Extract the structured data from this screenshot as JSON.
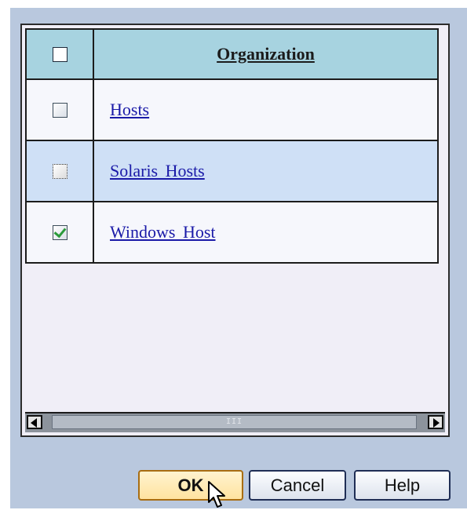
{
  "table": {
    "header": {
      "select_all_checked": false,
      "column_label": "Organization"
    },
    "rows": [
      {
        "label": "Hosts",
        "checked": false,
        "focused": false
      },
      {
        "label": "Solaris Hosts",
        "checked": false,
        "focused": true
      },
      {
        "label": "Windows Host",
        "checked": true,
        "focused": false
      }
    ]
  },
  "scrollbar": {
    "thumb_grip": "III"
  },
  "buttons": {
    "ok_label": "OK",
    "cancel_label": "Cancel",
    "help_label": "Help"
  },
  "colors": {
    "dialog_background": "#b9c8de",
    "header_background": "#a7d3e0",
    "selected_row_background": "#cfe0f6",
    "link_color": "#1a1aa8",
    "checkmark_color": "#2a9a3a",
    "ok_button_fill": "#ffe3a0"
  },
  "icons": {
    "cursor": "mouse-pointer-icon",
    "scroll_left": "arrow-left-icon",
    "scroll_right": "arrow-right-icon"
  }
}
